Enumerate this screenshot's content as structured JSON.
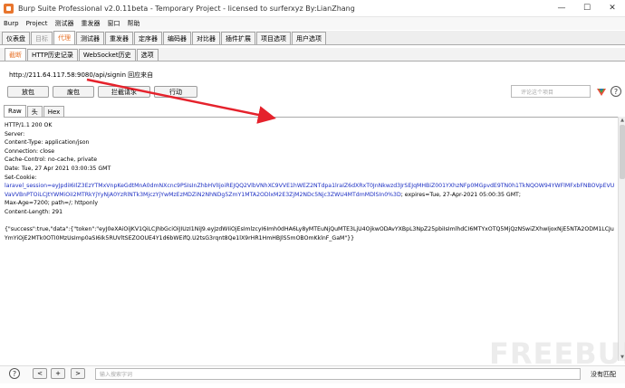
{
  "window": {
    "title": "Burp Suite Professional v2.0.11beta - Temporary Project - licensed to surferxyz By:LianZhang",
    "minimize": "—",
    "maximize": "☐",
    "close": "✕"
  },
  "menu": [
    "Burp",
    "Project",
    "测试器",
    "重发器",
    "窗口",
    "帮助"
  ],
  "main_tabs": [
    {
      "label": "仪表盘",
      "state": "normal"
    },
    {
      "label": "目标",
      "state": "dim"
    },
    {
      "label": "代理",
      "state": "active"
    },
    {
      "label": "测试器",
      "state": "normal"
    },
    {
      "label": "重发器",
      "state": "normal"
    },
    {
      "label": "定序器",
      "state": "normal"
    },
    {
      "label": "编码器",
      "state": "normal"
    },
    {
      "label": "对比器",
      "state": "normal"
    },
    {
      "label": "插件扩展",
      "state": "normal"
    },
    {
      "label": "项目选项",
      "state": "normal"
    },
    {
      "label": "用户选项",
      "state": "normal"
    }
  ],
  "sub_tabs": [
    {
      "label": "截断",
      "state": "active"
    },
    {
      "label": "HTTP历史记录",
      "state": "normal"
    },
    {
      "label": "WebSocket历史",
      "state": "normal"
    },
    {
      "label": "选项",
      "state": "normal"
    }
  ],
  "intercept": {
    "url": "http://211.64.117.58:9080/api/signin",
    "url_suffix": "回应来自"
  },
  "buttons": {
    "forward": "放包",
    "drop": "废包",
    "intercept": "拦截请求",
    "action": "行动"
  },
  "search_placeholder": "评论这个项目",
  "help": "?",
  "view_tabs": [
    {
      "label": "Raw",
      "state": "active"
    },
    {
      "label": "头",
      "state": "normal"
    },
    {
      "label": "Hex",
      "state": "normal"
    }
  ],
  "response": {
    "status": "HTTP/1.1 200 OK",
    "server": "Server:",
    "content_type": "Content-Type: application/json",
    "connection": "Connection: close",
    "cache_control": "Cache-Control: no-cache, private",
    "date": "Date: Tue, 27 Apr 2021 03:00:35 GMT",
    "set_cookie": "Set-Cookie:",
    "cookie_name": "laravel_session",
    "cookie_value": "=eyJpdiI6IlZ3EzYTMxVnpKeGdtMnA0dmNXcnc9PSIsInZhbHVlIjoiREJQQ2VlbVNhXC9VVE1hWEZ2NTdpa1lraIZ6dXRxT0JnNkwzd3JrSEJqMHBiZ001YXhzNFp0MGpvdE9TN0h1TkNQOW94YWFlMFxbFNBOVpEVUVaVVBnPTOiLCJtYWMiOiI2MTRkYjYyNjA0YzRlNTk3MjczYjYwMzEzMDZiN2NhNDg5ZmY1MTA2ODlxM2E3ZjM2NDc5Njc3ZWU4MTdmMDlSIn0%3D",
    "cookie_attrs": "; expires=Tue, 27-Apr-2021 05:00:35 GMT;",
    "max_age": "Max-Age=7200; path=/; httponly",
    "content_length": "Content-Length: 291",
    "body": "{\"success\":true,\"data\":{\"token\":\"eyJ0eXAiOiJKV1QiLCJhbGciOiJIUzI1NiJ9.eyJzdWIiOjEsImlzcyI6Imh0dHA6Ly8yMTEuNjQuMTE3LjU4OjkwODAvYXBpL3NpZ25pbiIsImlhdCI6MTYxOTQ5MjQzNSwiZXhwIjoxNjE5NTA2ODM1LCJuYmYiOjE2MTk0OTI0MzUsImp0aSI6Ik5RUVltSEZOOUE4Y1d6bWEifQ.U2tsG3rqnt8Qe1lX9rHR1HmHBJlS5mOBOmKklnF_GaM\"}}"
  },
  "bottom": {
    "help": "?",
    "prev": "<",
    "add": "+",
    "next": ">",
    "search_placeholder": "输入搜索字词",
    "match": "没有匹配"
  },
  "watermark": "FREEBUF",
  "colors": {
    "accent": "#e8752d",
    "cookie_blue": "#1c2fc3",
    "arrow_red": "#e5222c"
  }
}
